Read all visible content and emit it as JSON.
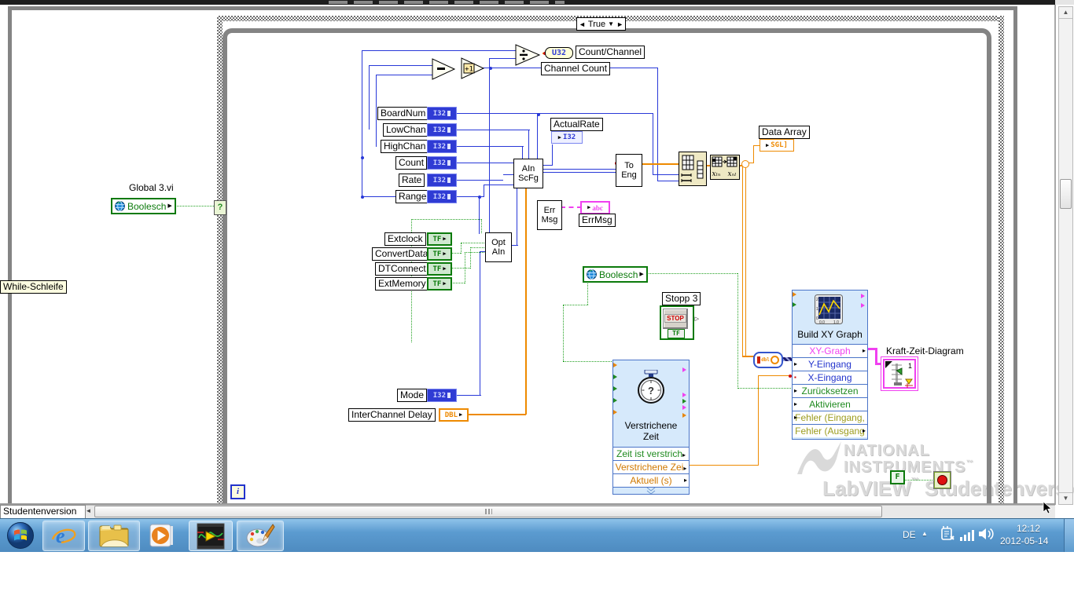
{
  "window": {
    "status_tab": "Studentenversion"
  },
  "case_structure": {
    "selector": "True",
    "left_arrow": "◄",
    "right_arrow": "►",
    "dropdown": "▼",
    "selector_terminal": "?"
  },
  "loop": {
    "iteration": "i",
    "false_constant": "F"
  },
  "left_panel": {
    "vi_label": "Global 3.vi",
    "global_label": "Boolesch",
    "while_label": "While-Schleife"
  },
  "types": {
    "i32": "I32",
    "tf": "TF",
    "dbl": "DBL",
    "u32": "U32",
    "sgl": "SGL]",
    "abc": "abc"
  },
  "int_controls": [
    "BoardNum",
    "LowChan",
    "HighChan",
    "Count",
    "Rate",
    "Range"
  ],
  "bool_controls": [
    "Extclock",
    "ConvertData",
    "DTConnect",
    "ExtMemory"
  ],
  "mode_label": "Mode",
  "interchannel_label": "InterChannel Delay",
  "nodes": {
    "ain1": "AIn",
    "ain2": "ScFg",
    "opt1": "Opt",
    "opt2": "AIn",
    "err1": "Err",
    "err2": "Msg",
    "toeng1": "To",
    "toeng2": "Eng"
  },
  "indicators": {
    "count_channel": "Count/Channel",
    "channel_count": "Channel Count",
    "actual_rate": "ActualRate",
    "data_array": "Data Array",
    "errmsg": "ErrMsg",
    "kraft": "Kraft-Zeit-Diagram",
    "kraft_digit": "1"
  },
  "stop_button": {
    "label": "Stopp 3",
    "icon_text": "STOP",
    "tf": "TF"
  },
  "global2_label": "Boolesch",
  "express_elapsed": {
    "title1": "Verstrichene",
    "title2": "Zeit",
    "rows": [
      "Zeit ist verstrich",
      "Verstrichene Zei",
      "Aktuell (s)"
    ]
  },
  "express_xy": {
    "title": "Build XY Graph",
    "rows": [
      "XY-Graph",
      "Y-Eingang",
      "X-Eingang",
      "Zurücksetzen",
      "Aktivieren",
      "Fehler (Eingang,",
      "Fehler (Ausgang"
    ]
  },
  "watermark": {
    "l1": "NATIONAL",
    "l2": "INSTRUMENTS",
    "tm": "™",
    "l3a": "LabVIEW",
    "l3tm": "™",
    "l3b": "Studentenversion"
  },
  "taskbar": {
    "language": "DE",
    "time": "12:12",
    "date": "2012-05-14"
  },
  "colors": {
    "wire_blue": "#2838d8",
    "wire_orange": "#ee8a00",
    "wire_green": "#23a123",
    "wire_pink": "#f040f0",
    "tf_green": "#0b7a0b"
  }
}
